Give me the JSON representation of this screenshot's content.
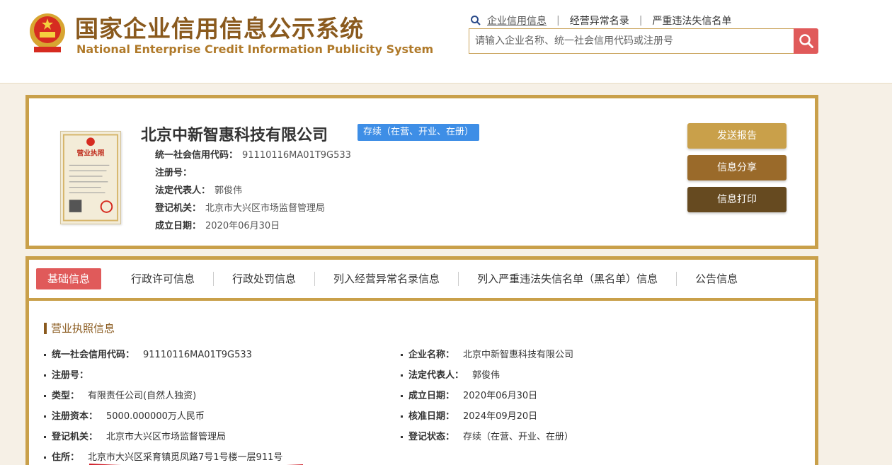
{
  "header": {
    "title_cn": "国家企业信用信息公示系统",
    "title_en": "National Enterprise Credit Information Publicity System",
    "links": [
      "企业信用信息",
      "经营异常名录",
      "严重违法失信名单"
    ],
    "search_placeholder": "请输入企业名称、统一社会信用代码或注册号"
  },
  "company": {
    "name": "北京中新智惠科技有限公司",
    "status": "存续（在营、开业、在册）",
    "license_text": "营业执照",
    "fields": [
      {
        "label": "统一社会信用代码：",
        "value": "91110116MA01T9G533"
      },
      {
        "label": "注册号：",
        "value": ""
      },
      {
        "label": "法定代表人：",
        "value": "郭俊伟"
      },
      {
        "label": "登记机关：",
        "value": "北京市大兴区市场监督管理局"
      },
      {
        "label": "成立日期：",
        "value": "2020年06月30日"
      }
    ],
    "buttons": {
      "report": "发送报告",
      "share": "信息分享",
      "print": "信息打印"
    }
  },
  "tabs": [
    "基础信息",
    "行政许可信息",
    "行政处罚信息",
    "列入经营异常名录信息",
    "列入严重违法失信名单（黑名单）信息",
    "公告信息"
  ],
  "section": {
    "title": "营业执照信息",
    "left": [
      {
        "label": "统一社会信用代码：",
        "value": "91110116MA01T9G533"
      },
      {
        "label": "注册号：",
        "value": ""
      },
      {
        "label": "类型：",
        "value": "有限责任公司(自然人独资)"
      },
      {
        "label": "注册资本：",
        "value": "5000.000000万人民币"
      },
      {
        "label": "登记机关：",
        "value": "北京市大兴区市场监督管理局"
      },
      {
        "label": "住所：",
        "value": "北京市大兴区采育镇觅凤路7号1号楼一层911号"
      }
    ],
    "right": [
      {
        "label": "企业名称：",
        "value": "北京中新智惠科技有限公司"
      },
      {
        "label": "法定代表人：",
        "value": "郭俊伟"
      },
      {
        "label": "成立日期：",
        "value": "2020年06月30日"
      },
      {
        "label": "核准日期：",
        "value": "2024年09月20日"
      },
      {
        "label": "登记状态：",
        "value": "存续（在营、开业、在册）"
      }
    ]
  },
  "colors": {
    "gold": "#c9a04a",
    "brown": "#8a5a1e",
    "red": "#e05a5a",
    "blue": "#3e8ee6"
  }
}
